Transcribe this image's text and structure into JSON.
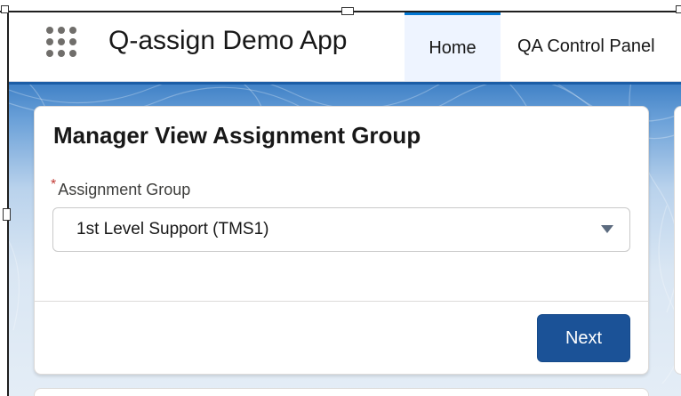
{
  "header": {
    "app_name": "Q-assign Demo App",
    "tabs": [
      {
        "label": "Home",
        "active": true
      },
      {
        "label": "QA Control Panel",
        "active": false
      }
    ]
  },
  "card": {
    "title": "Manager View Assignment Group",
    "field": {
      "required_marker": "*",
      "label": "Assignment Group",
      "selected_value": "1st Level Support (TMS1)"
    },
    "next_label": "Next"
  },
  "colors": {
    "brand_button": "#1b5297",
    "active_tab_border": "#0176d3",
    "required": "#c23934",
    "banner": "#3d7fc5"
  }
}
